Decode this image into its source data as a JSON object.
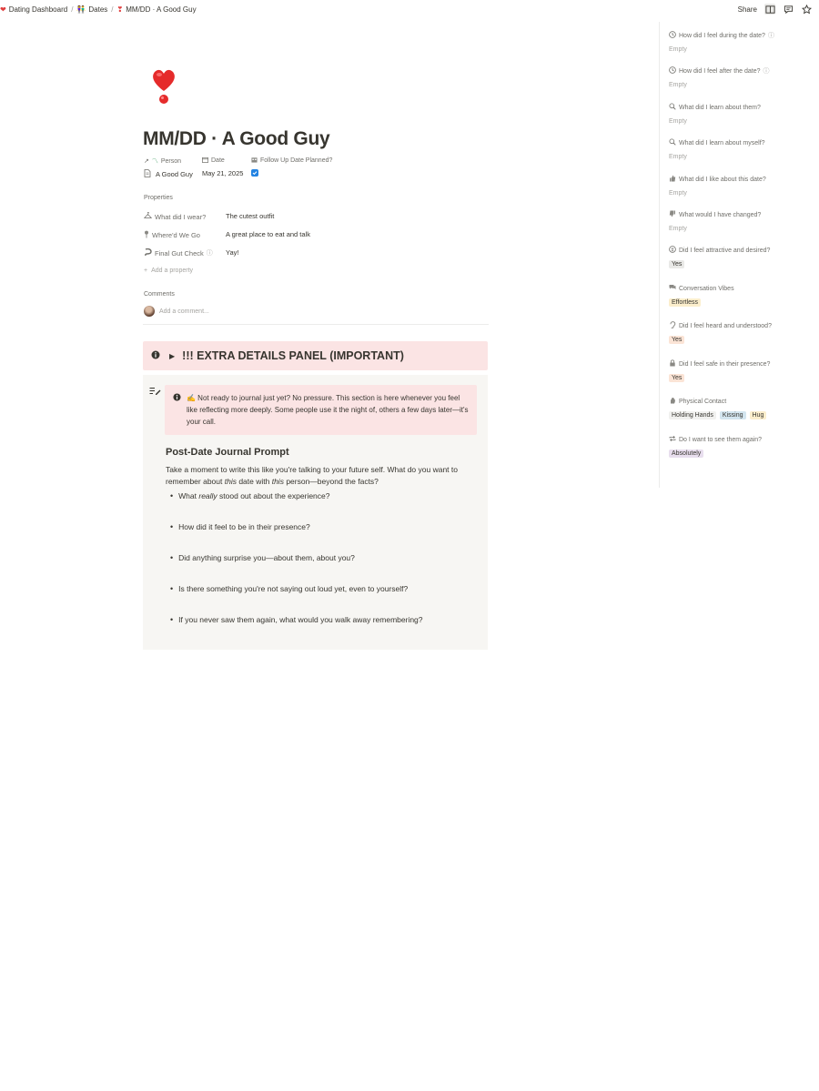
{
  "breadcrumbs": [
    {
      "icon": "heart-icon",
      "label": "Dating Dashboard"
    },
    {
      "icon": "couple-icon",
      "label": "Dates"
    },
    {
      "icon": "heart-exclamation-icon",
      "label": "MM/DD · A Good Guy"
    }
  ],
  "topbar": {
    "share_label": "Share"
  },
  "page": {
    "title": "MM/DD · A Good Guy",
    "icon": "heart-exclamation-icon"
  },
  "header_props": {
    "person": {
      "label": "Person",
      "value": "A Good Guy"
    },
    "date": {
      "label": "Date",
      "value": "May 21, 2025"
    },
    "follow_up": {
      "label": "Follow Up Date Planned?",
      "checked": true
    }
  },
  "properties": {
    "section_label": "Properties",
    "rows": [
      {
        "label": "What did I wear?",
        "value": "The cutest outfit",
        "icon": "hanger-icon"
      },
      {
        "label": "Where'd We Go",
        "value": "A great place to eat and talk",
        "icon": "pin-icon"
      },
      {
        "label": "Final Gut Check",
        "value": "Yay!",
        "icon": "gut-icon"
      }
    ],
    "add_label": "Add a property"
  },
  "comments": {
    "label": "Comments",
    "placeholder": "Add a comment..."
  },
  "extra_callout": {
    "title": "!!! EXTRA DETAILS PANEL (IMPORTANT)"
  },
  "journal": {
    "note": "✍️ Not ready to journal just yet? No pressure. This section is here whenever you feel like reflecting more deeply. Some people use it the night of, others a few days later—it's your call.",
    "heading": "Post-Date Journal Prompt",
    "intro_1": "Take a moment to write this like you're talking to your future self. What do you want to remember about ",
    "intro_em1": "this",
    "intro_2": " date with ",
    "intro_em2": "this",
    "intro_3": " person—beyond the facts?",
    "bullets": [
      "What really stood out about the experience?",
      "How did it feel to be in their presence?",
      "Did anything surprise you—about them, about you?",
      "Is there something you're not saying out loud yet, even to yourself?",
      "If you never saw them again, what would you walk away remembering?"
    ]
  },
  "sidebar": {
    "items": [
      {
        "label": "How did I feel during the date?",
        "value": "Empty",
        "icon": "clock-icon",
        "info": true
      },
      {
        "label": "How did I feel after the date?",
        "value": "Empty",
        "icon": "clock-icon",
        "info": true
      },
      {
        "label": "What did I learn about them?",
        "value": "Empty",
        "icon": "search-icon"
      },
      {
        "label": "What did I learn about myself?",
        "value": "Empty",
        "icon": "search-icon"
      },
      {
        "label": "What did I like about this date?",
        "value": "Empty",
        "icon": "thumbs-up-icon"
      },
      {
        "label": "What would I have changed?",
        "value": "Empty",
        "icon": "thumbs-down-icon"
      },
      {
        "label": "Did I feel attractive and desired?",
        "tags": [
          {
            "text": "Yes",
            "color": "#e9e9e7"
          }
        ],
        "icon": "sparkle-icon"
      },
      {
        "label": "Conversation Vibes",
        "tags": [
          {
            "text": "Effortless",
            "color": "#fbeecc"
          }
        ],
        "icon": "chat-icon"
      },
      {
        "label": "Did I feel heard and understood?",
        "tags": [
          {
            "text": "Yes",
            "color": "#fbe4d6"
          }
        ],
        "icon": "ear-icon"
      },
      {
        "label": "Did I feel safe in their presence?",
        "tags": [
          {
            "text": "Yes",
            "color": "#fbe4d6"
          }
        ],
        "icon": "lock-icon"
      },
      {
        "label": "Physical Contact",
        "tags": [
          {
            "text": "Holding Hands",
            "color": "#f1f1ef"
          },
          {
            "text": "Kissing",
            "color": "#d3e5ef"
          },
          {
            "text": "Hug",
            "color": "#fbeecc"
          }
        ],
        "icon": "hand-icon"
      },
      {
        "label": "Do I want to see them again?",
        "tags": [
          {
            "text": "Absolutely",
            "color": "#e8deee"
          }
        ],
        "icon": "repeat-icon"
      }
    ]
  }
}
